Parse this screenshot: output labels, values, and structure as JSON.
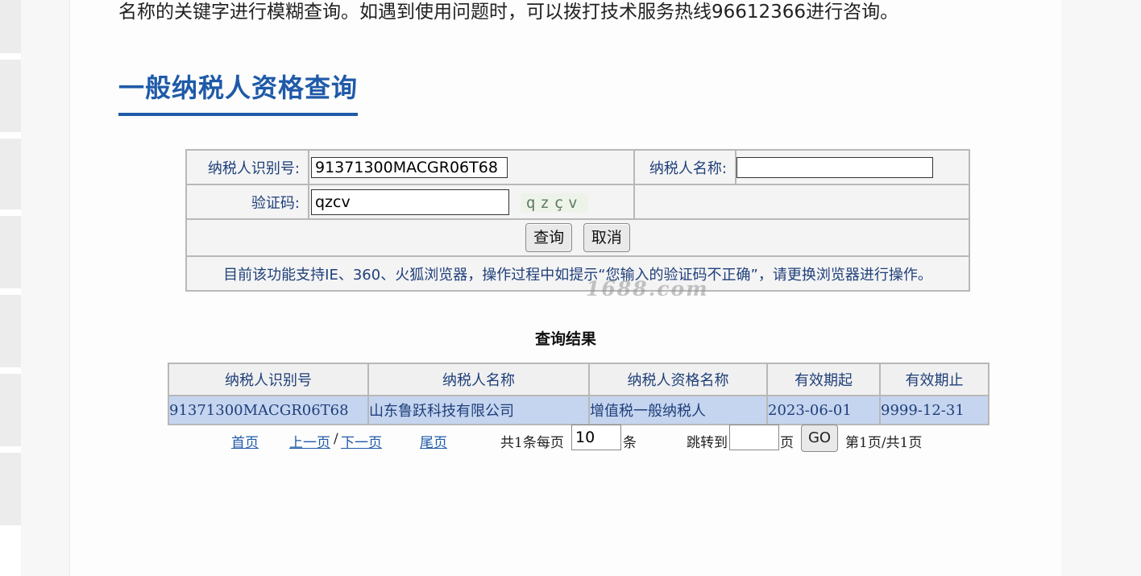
{
  "intro_text": "名称的关键字进行模糊查询。如遇到使用问题时，可以拨打技术服务热线96612366进行咨询。",
  "section_title": "一般纳税人资格查询",
  "form": {
    "taxpayer_id_label": "纳税人识别号:",
    "taxpayer_id_value": "91371300MACGR06T68",
    "taxpayer_name_label": "纳税人名称:",
    "taxpayer_name_value": "",
    "captcha_label": "验证码:",
    "captcha_value": "qzcv",
    "captcha_image_text": "qzçv",
    "query_button": "查询",
    "cancel_button": "取消",
    "notice": "目前该功能支持IE、360、火狐浏览器，操作过程中如提示“您输入的验证码不正确”，请更换浏览器进行操作。"
  },
  "watermark": "1688.com",
  "results": {
    "title": "查询结果",
    "columns": [
      "纳税人识别号",
      "纳税人名称",
      "纳税人资格名称",
      "有效期起",
      "有效期止"
    ],
    "rows": [
      [
        "91371300MACGR06T68",
        "山东鲁跃科技有限公司",
        "增值税一般纳税人",
        "2023-06-01",
        "9999-12-31"
      ]
    ]
  },
  "pager": {
    "first": "首页",
    "prev": "上一页",
    "slash": "/",
    "next": "下一页",
    "last": "尾页",
    "total_prefix": "共1条每页",
    "per_page": "10",
    "per_page_unit": "条",
    "jump_label": "跳转到",
    "jump_value": "",
    "jump_unit": "页",
    "go": "GO",
    "status": "第1页/共1页"
  }
}
